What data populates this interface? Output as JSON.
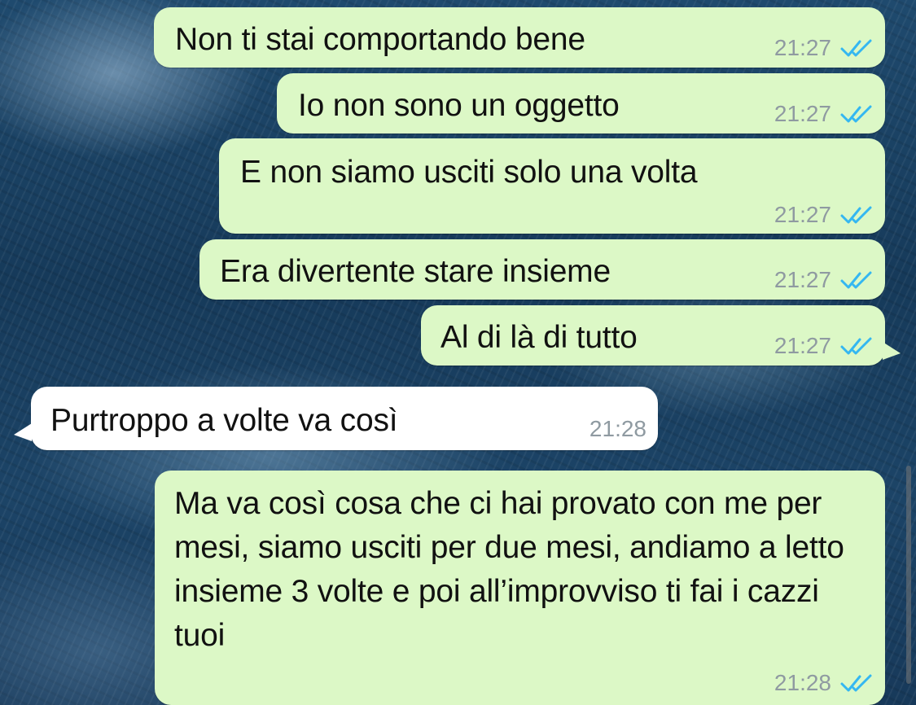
{
  "colors": {
    "outgoing_bubble": "#dcf8c6",
    "incoming_bubble": "#ffffff",
    "read_ticks": "#34b7f1",
    "timestamp": "#8f9aa1"
  },
  "messages": [
    {
      "direction": "outgoing",
      "text": "Non ti stai comportando bene",
      "time": "21:27",
      "status": "read"
    },
    {
      "direction": "outgoing",
      "text": "Io non sono un oggetto",
      "time": "21:27",
      "status": "read"
    },
    {
      "direction": "outgoing",
      "text": "E non siamo usciti solo una volta",
      "time": "21:27",
      "status": "read"
    },
    {
      "direction": "outgoing",
      "text": "Era divertente stare insieme",
      "time": "21:27",
      "status": "read"
    },
    {
      "direction": "outgoing",
      "text": "Al di là di tutto",
      "time": "21:27",
      "status": "read"
    },
    {
      "direction": "incoming",
      "text": "Purtroppo a volte va così",
      "time": "21:28"
    },
    {
      "direction": "outgoing",
      "text": "Ma va così cosa che ci hai provato con me per mesi, siamo usciti per due mesi, andiamo a letto insieme 3 volte e poi all’improvviso ti fai i cazzi tuoi",
      "time": "21:28",
      "status": "read"
    }
  ],
  "icons": {
    "read_status": "double-check-icon"
  }
}
